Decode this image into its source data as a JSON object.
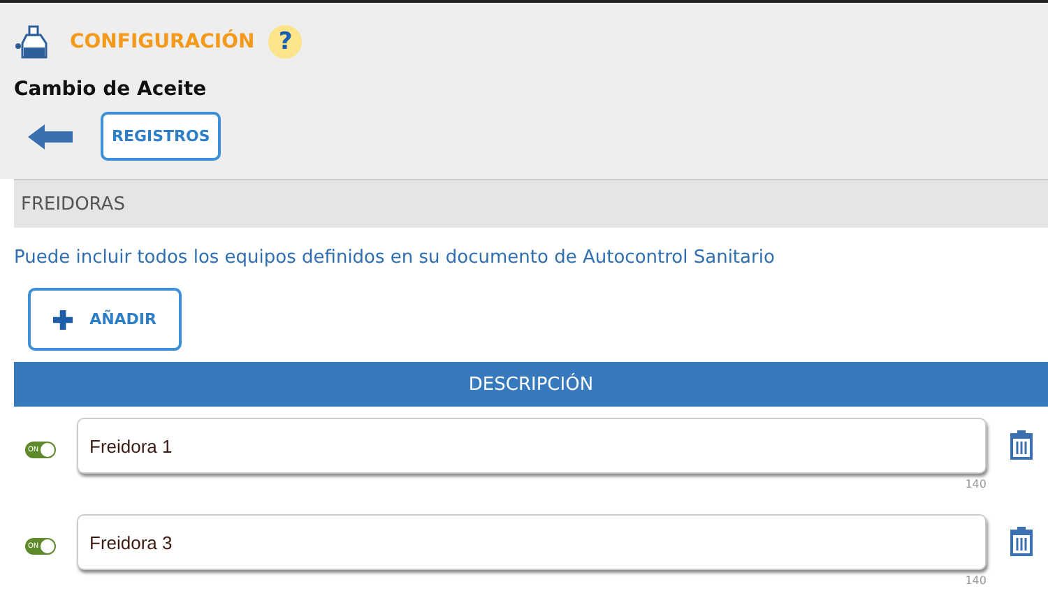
{
  "header": {
    "title": "CONFIGURACIÓN",
    "help": "?",
    "subtitle": "Cambio de Aceite",
    "registros_button": "REGISTROS"
  },
  "section": {
    "title": "FREIDORAS",
    "hint": "Puede incluir todos los equipos definidos en su documento de Autocontrol Sanitario",
    "add_button": "AÑADIR"
  },
  "table": {
    "column": "DESCRIPCIÓN",
    "rows": [
      {
        "on": true,
        "switch_label": "ON",
        "value": "Freidora 1",
        "counter": "140"
      },
      {
        "on": true,
        "switch_label": "ON",
        "value": "Freidora 3",
        "counter": "140"
      }
    ]
  }
}
